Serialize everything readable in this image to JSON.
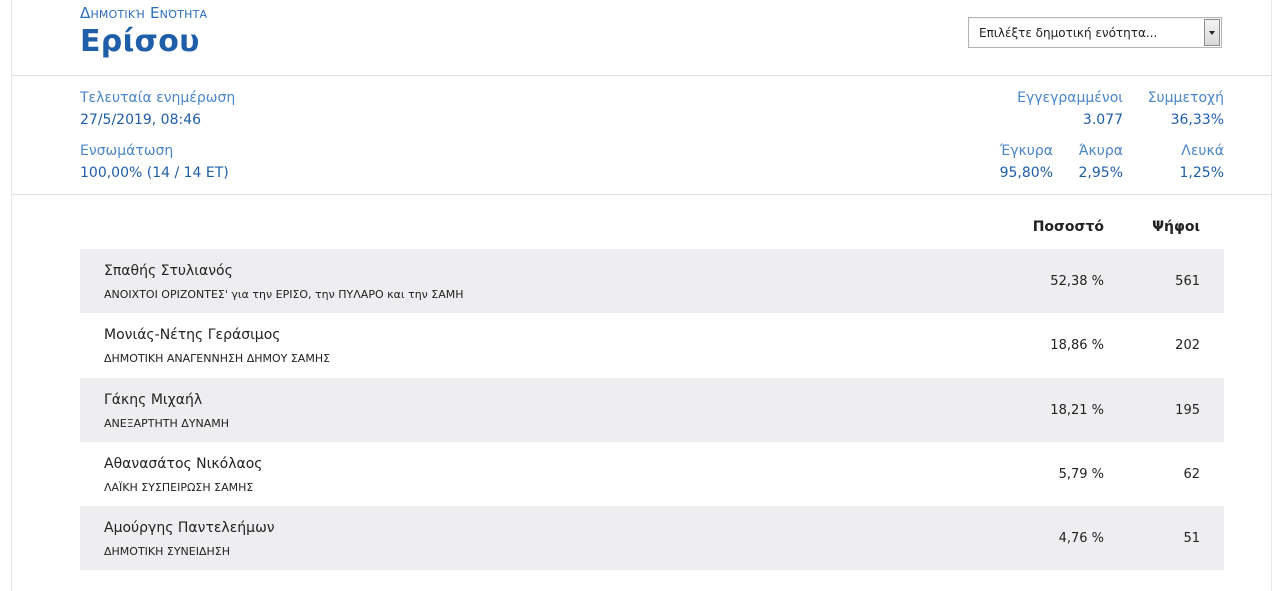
{
  "header": {
    "unit_label": "Δημοτική Ενότητα",
    "unit_name": "Ερίσου",
    "select_placeholder": "Επιλέξτε δημοτική ενότητα..."
  },
  "stats": {
    "last_update": {
      "label": "Τελευταία ενημέρωση",
      "value": "27/5/2019, 08:46"
    },
    "integration": {
      "label": "Ενσωμάτωση",
      "value": "100,00% (14 / 14 ΕΤ)"
    },
    "registered": {
      "label": "Εγγεγραμμένοι",
      "value": "3.077"
    },
    "participation": {
      "label": "Συμμετοχή",
      "value": "36,33%"
    },
    "valid": {
      "label": "Έγκυρα",
      "value": "95,80%"
    },
    "invalid": {
      "label": "Άκυρα",
      "value": "2,95%"
    },
    "blank": {
      "label": "Λευκά",
      "value": "1,25%"
    }
  },
  "table": {
    "col_percent": "Ποσοστό",
    "col_votes": "Ψήφοι",
    "rows": [
      {
        "name": "Σπαθής Στυλιανός",
        "party": "ΑΝΟΙΧΤΟΙ ΟΡΙΖΟΝΤΕΣ' για την ΕΡΙΣΟ, την ΠΥΛΑΡΟ και την ΣΑΜΗ",
        "percent": "52,38 %",
        "votes": "561"
      },
      {
        "name": "Μονιάς-Νέτης Γεράσιμος",
        "party": "ΔΗΜΟΤΙΚΗ ΑΝΑΓΕΝΝΗΣΗ ΔΗΜΟΥ ΣΑΜΗΣ",
        "percent": "18,86 %",
        "votes": "202"
      },
      {
        "name": "Γάκης Μιχαήλ",
        "party": "ΑΝΕΞΑΡΤΗΤΗ ΔΥΝΑΜΗ",
        "percent": "18,21 %",
        "votes": "195"
      },
      {
        "name": "Αθανασάτος Νικόλαος",
        "party": "ΛΑΪΚΗ ΣΥΣΠΕΙΡΩΣΗ ΣΑΜΗΣ",
        "percent": "5,79 %",
        "votes": "62"
      },
      {
        "name": "Αμούργης Παντελεήμων",
        "party": "ΔΗΜΟΤΙΚΗ ΣΥΝΕΙΔΗΣΗ",
        "percent": "4,76 %",
        "votes": "51"
      }
    ]
  },
  "colors": {
    "accent": "#1f5ea8",
    "label_blue": "#4a86c8",
    "row_shade": "#eeeef0"
  }
}
